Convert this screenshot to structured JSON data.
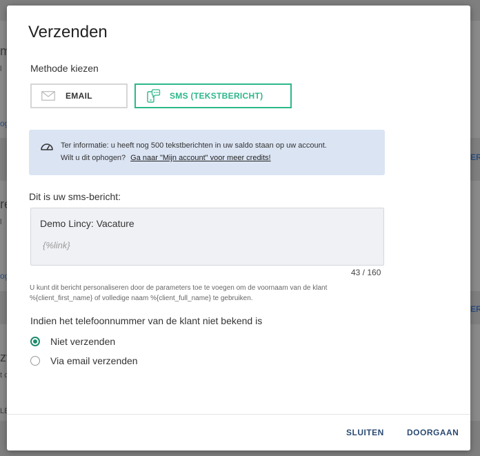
{
  "background": {
    "fragments": [
      "m",
      "l",
      "og",
      "ERZ",
      "re",
      "l",
      "og",
      "ERZ",
      "zv",
      "t c",
      "LE"
    ]
  },
  "modal": {
    "title": "Verzenden",
    "method_label": "Methode kiezen",
    "methods": {
      "email": "EMAIL",
      "sms": "SMS (TEKSTBERICHT)"
    },
    "info": {
      "line1": "Ter informatie: u heeft nog 500 tekstberichten in uw saldo staan op uw account.",
      "line2_question": "Wilt u dit ophogen?",
      "line2_link": "Ga naar \"Mijn account\" voor meer credits!"
    },
    "sms_label": "Dit is uw sms-bericht:",
    "sms_text": "Demo Lincy: Vacature",
    "sms_link_placeholder": "{%link}",
    "counter": "43 / 160",
    "hint_line1": "U kunt dit bericht personaliseren door de parameters toe te voegen om de voornaam van de klant",
    "hint_line2": "%{client_first_name} of volledige naam %{client_full_name} te gebruiken.",
    "phone_question": "Indien het telefoonnummer van de klant niet bekend is",
    "options": [
      {
        "label": "Niet verzenden",
        "selected": true
      },
      {
        "label": "Via email verzenden",
        "selected": false
      }
    ],
    "footer": {
      "close": "SLUITEN",
      "continue": "DOORGAAN"
    }
  },
  "colors": {
    "accent_green": "#2bb78a",
    "radio_green": "#1d8a6c",
    "info_bg": "#dbe4f3",
    "footer_link": "#2b4a73"
  }
}
